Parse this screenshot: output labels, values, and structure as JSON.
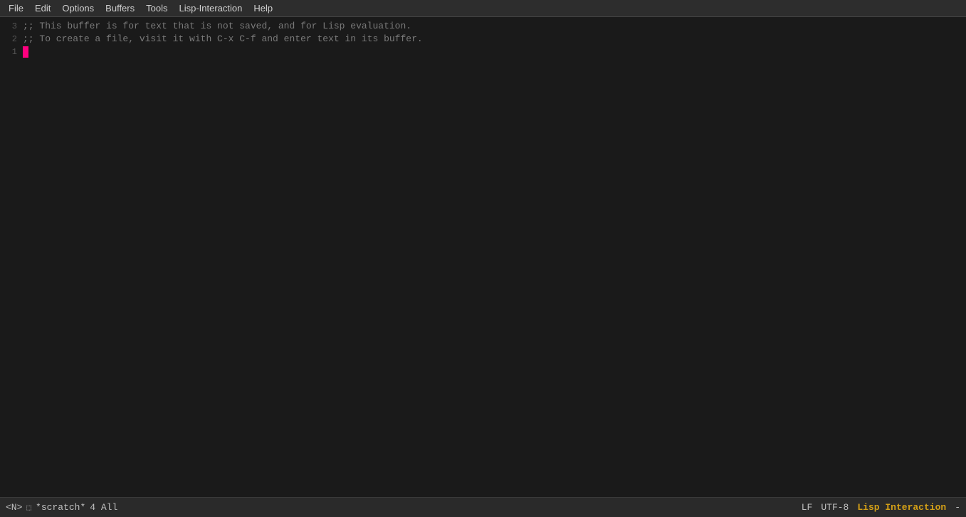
{
  "menubar": {
    "items": [
      {
        "label": "File",
        "id": "file"
      },
      {
        "label": "Edit",
        "id": "edit"
      },
      {
        "label": "Options",
        "id": "options"
      },
      {
        "label": "Buffers",
        "id": "buffers"
      },
      {
        "label": "Tools",
        "id": "tools"
      },
      {
        "label": "Lisp-Interaction",
        "id": "lisp-interaction"
      },
      {
        "label": "Help",
        "id": "help"
      }
    ]
  },
  "editor": {
    "lines": [
      {
        "number": "3",
        "content": ";; This buffer is for text that is not saved, and for Lisp evaluation."
      },
      {
        "number": "2",
        "content": ";; To create a file, visit it with C-x C-f and enter text in its buffer."
      },
      {
        "number": "1",
        "content": ""
      }
    ],
    "cursor_line": "1",
    "cursor_visible": true
  },
  "statusbar": {
    "buffer_indicator": "<N>",
    "buffer_icon": "⬛",
    "buffer_name": "*scratch*",
    "position": "4  All",
    "line_ending": "LF",
    "encoding": "UTF-8",
    "mode": "Lisp Interaction",
    "end_marker": "-"
  }
}
